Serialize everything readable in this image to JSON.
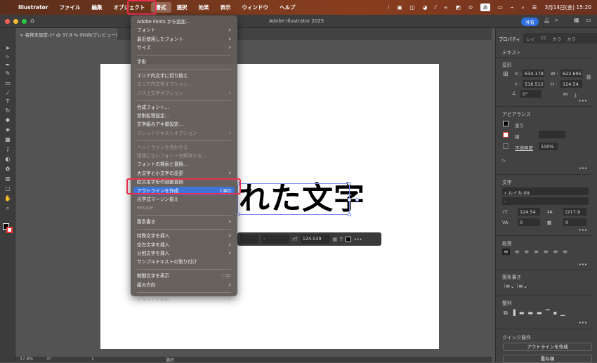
{
  "menubar": {
    "app": "Illustrator",
    "items": [
      "ファイル",
      "編集",
      "オブジェクト",
      "書式",
      "選択",
      "効果",
      "表示",
      "ウィンドウ",
      "ヘルプ"
    ],
    "active": "書式",
    "clock": "3月14日(金) 15:20",
    "ime": "あ"
  },
  "window": {
    "title": "Adobe Illustrator 2025",
    "tab": "名称未設定-1* @ 37.8 % (RGB/プレビュー)",
    "share": "共有"
  },
  "canvas": {
    "text": "れた文字"
  },
  "type_menu": [
    {
      "label": "Adobe Fonts から追加..."
    },
    {
      "label": "フォント",
      "sub": true
    },
    {
      "label": "最近使用したフォント",
      "sub": true
    },
    {
      "label": "サイズ",
      "sub": true
    },
    {
      "sep": true
    },
    {
      "label": "字形"
    },
    {
      "sep": true
    },
    {
      "label": "エリア内文字に切り換え"
    },
    {
      "label": "エリア内文字オプション...",
      "disabled": true
    },
    {
      "label": "パス上文字オプション",
      "sub": true,
      "disabled": true
    },
    {
      "sep": true
    },
    {
      "label": "合成フォント..."
    },
    {
      "label": "禁則処理設定..."
    },
    {
      "label": "文字組みアキ量設定..."
    },
    {
      "label": "スレッドテキストオプション",
      "sub": true,
      "disabled": true
    },
    {
      "sep": true
    },
    {
      "label": "ヘッドラインを合わせる",
      "disabled": true
    },
    {
      "label": "環境にないフォントを解決する...",
      "disabled": true
    },
    {
      "label": "フォントの検索と置換..."
    },
    {
      "label": "大文字と小文字の変更",
      "sub": true
    },
    {
      "label": "欧文用字形の自動置換"
    },
    {
      "label": "アウトラインを作成",
      "shortcut": "⇧⌘O",
      "highlighted": true
    },
    {
      "label": "光学式マージン揃え"
    },
    {
      "label": "Retype",
      "disabled": true
    },
    {
      "sep": true
    },
    {
      "label": "箇条書き",
      "sub": true
    },
    {
      "sep": true
    },
    {
      "label": "特殊文字を挿入",
      "sub": true
    },
    {
      "label": "空白文字を挿入",
      "sub": true
    },
    {
      "label": "分割文字を挿入",
      "sub": true
    },
    {
      "label": "サンプルテキストの割り付け"
    },
    {
      "sep": true
    },
    {
      "label": "制御文字を表示",
      "shortcut": "⌥⌘I",
      "shortcut_disabled": true
    },
    {
      "label": "組み方向",
      "sub": true
    },
    {
      "sep": true
    },
    {
      "label": "テキストを更新",
      "sub": true,
      "disabled": true
    }
  ],
  "context_bar": {
    "style": "-",
    "size": "124.539"
  },
  "panel": {
    "tabs": [
      "プロパティ",
      "レイ",
      "CC",
      "カラ",
      "カラ"
    ],
    "section_title": "テキスト",
    "transform": {
      "title": "変形",
      "x_label": "X :",
      "x": "634.178",
      "y_label": "Y :",
      "y": "516.512",
      "w_label": "W :",
      "w": "622.695",
      "h_label": "H :",
      "h": "124.54",
      "angle": "0°"
    },
    "appearance": {
      "title": "アピアランス",
      "fill": "塗り",
      "stroke": "線",
      "opacity_label": "不透明度",
      "opacity": "100%",
      "fx": "fx."
    },
    "character": {
      "title": "文字",
      "font": "ルイカ-09",
      "style": "-",
      "size": "124.54",
      "leading": "(217.9",
      "kerning": "0",
      "tracking": "0"
    },
    "paragraph": {
      "title": "段落"
    },
    "bullets": {
      "title": "箇条書き"
    },
    "align": {
      "title": "整列"
    },
    "quick": {
      "title": "クイック操作",
      "btn1": "アウトラインを作成",
      "btn2": "重ね順"
    }
  },
  "statusbar": {
    "zoom": "37.8%",
    "rotate": "0°",
    "artboard": "1",
    "tool": "選択"
  }
}
